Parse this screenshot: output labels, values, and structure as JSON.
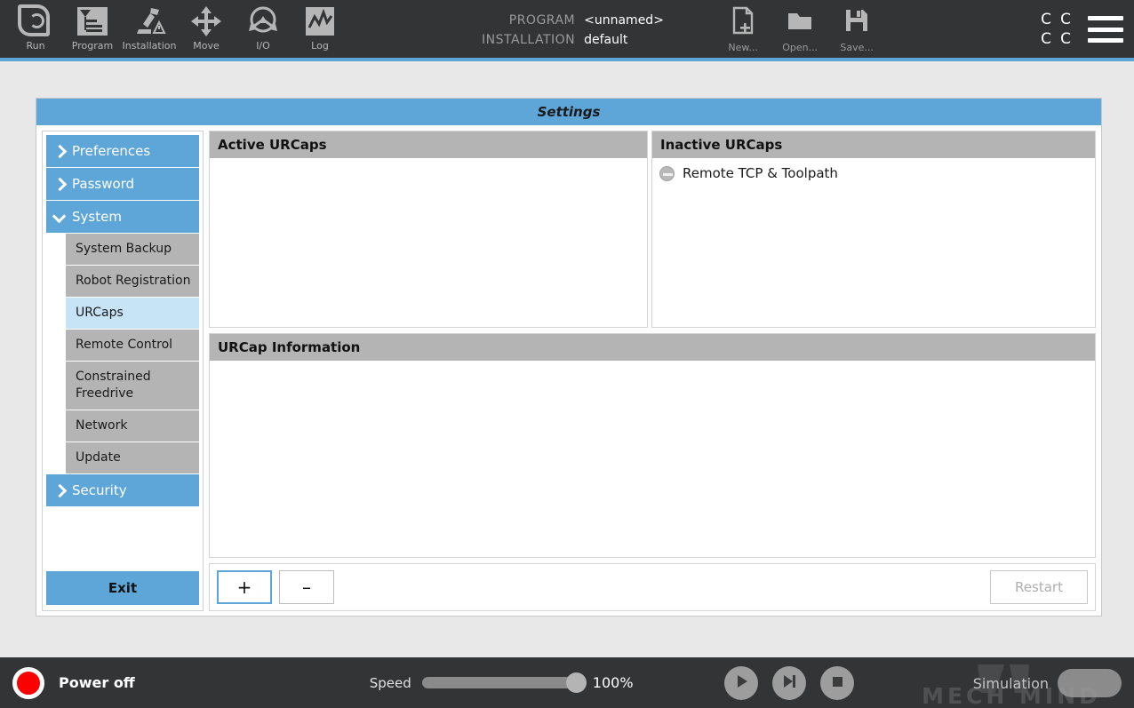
{
  "topbar": {
    "nav_items": [
      {
        "label": "Run",
        "icon": "ur-logo-icon"
      },
      {
        "label": "Program",
        "icon": "program-icon"
      },
      {
        "label": "Installation",
        "icon": "installation-robot-icon"
      },
      {
        "label": "Move",
        "icon": "move-arrows-icon"
      },
      {
        "label": "I/O",
        "icon": "io-icon"
      },
      {
        "label": "Log",
        "icon": "log-graph-icon"
      }
    ],
    "program_key": "PROGRAM",
    "program_value": "<unnamed>",
    "installation_key": "INSTALLATION",
    "installation_value": "default",
    "file_actions": [
      {
        "label": "New...",
        "icon": "new-file-icon"
      },
      {
        "label": "Open...",
        "icon": "open-folder-icon"
      },
      {
        "label": "Save...",
        "icon": "save-floppy-icon"
      }
    ],
    "lang_cells": [
      "C",
      "C",
      "C",
      "C"
    ],
    "menu_icon": "hamburger-menu-icon"
  },
  "window": {
    "title": "Settings"
  },
  "sidebar": {
    "groups": [
      {
        "label": "Preferences",
        "expanded": false
      },
      {
        "label": "Password",
        "expanded": false
      },
      {
        "label": "System",
        "expanded": true
      }
    ],
    "system_items": [
      {
        "label": "System Backup",
        "active": false
      },
      {
        "label": "Robot Registration",
        "active": false
      },
      {
        "label": "URCaps",
        "active": true
      },
      {
        "label": "Remote Control",
        "active": false
      },
      {
        "label": "Constrained Freedrive",
        "active": false
      },
      {
        "label": "Network",
        "active": false
      },
      {
        "label": "Update",
        "active": false
      }
    ],
    "security": {
      "label": "Security",
      "expanded": false
    },
    "exit_label": "Exit"
  },
  "content": {
    "active_panel_title": "Active URCaps",
    "active_urcaps": [],
    "inactive_panel_title": "Inactive URCaps",
    "inactive_urcaps": [
      {
        "name": "Remote TCP & Toolpath",
        "icon": "disabled-minus-icon"
      }
    ],
    "info_panel_title": "URCap Information",
    "info_text": "",
    "add_label": "+",
    "remove_label": "–",
    "restart_label": "Restart",
    "restart_enabled": false
  },
  "bottombar": {
    "power_label": "Power off",
    "power_state_color": "#ff0000",
    "speed_label": "Speed",
    "speed_value": "100%",
    "speed_percent": 100,
    "transport": [
      {
        "name": "play-button",
        "icon": "play-icon"
      },
      {
        "name": "step-button",
        "icon": "step-forward-icon"
      },
      {
        "name": "stop-button",
        "icon": "stop-icon"
      }
    ],
    "simulation_label": "Simulation",
    "watermark_text": "MECH MIND"
  },
  "colors": {
    "accent_blue": "#5ea6d8",
    "selected_blue": "#c7e3f6",
    "panel_gray": "#b4b4b4",
    "dark_chrome": "#333435",
    "power_red": "#ff0000"
  }
}
